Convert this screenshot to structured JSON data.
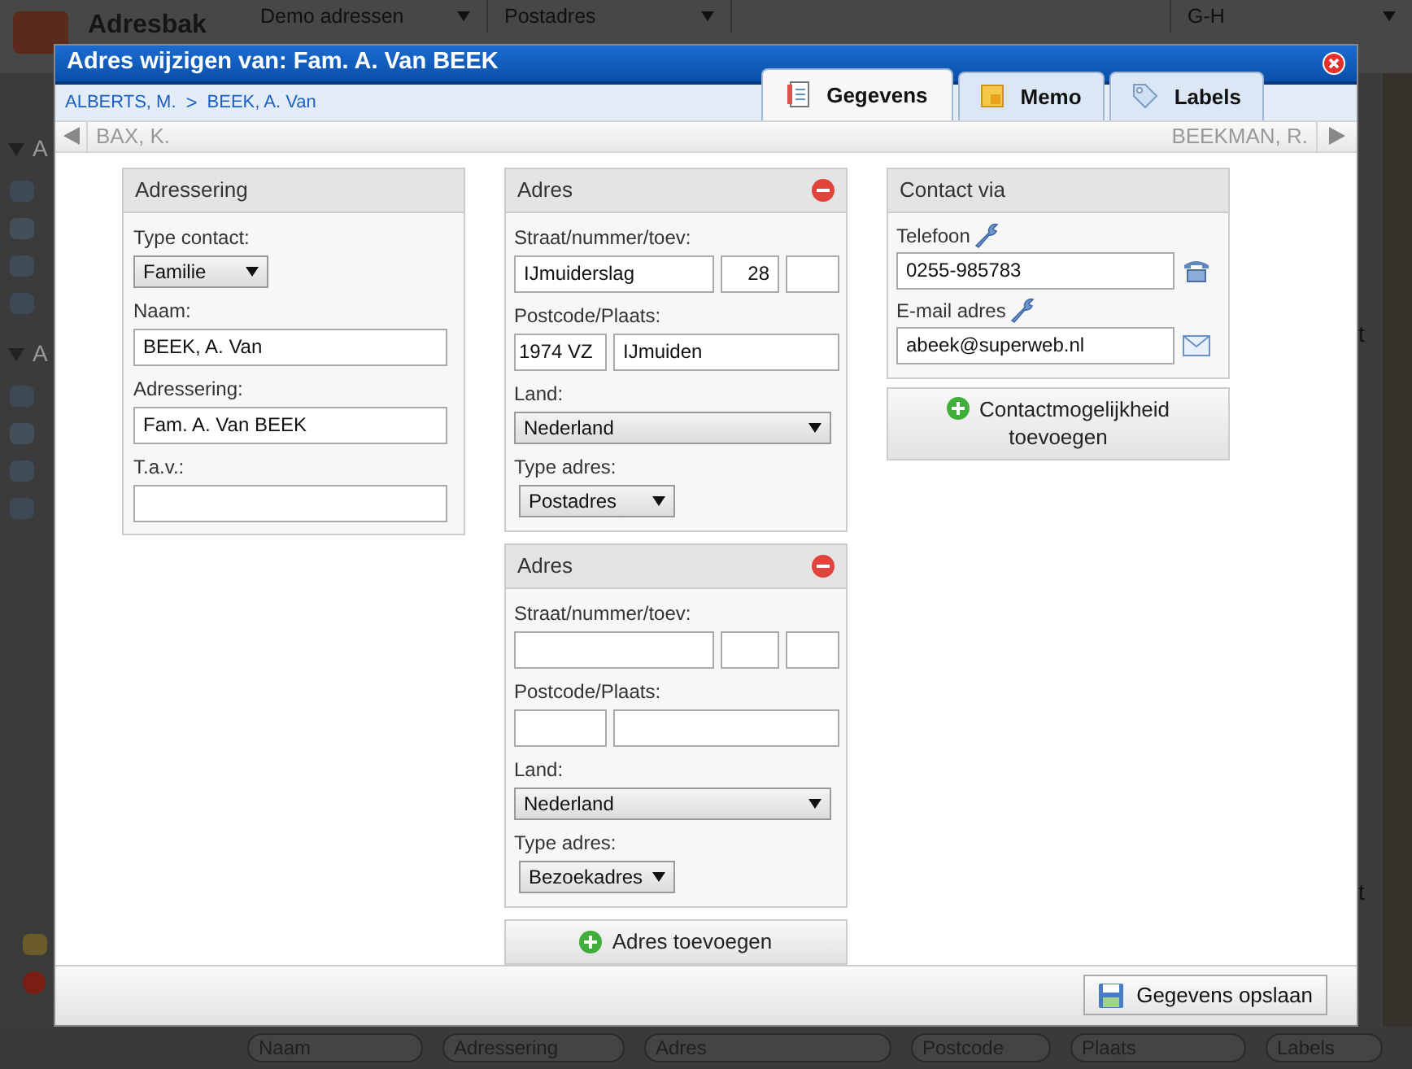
{
  "app": {
    "title": "Adresbak",
    "filters": [
      "Demo adressen",
      "Postadres"
    ],
    "letter_range": "G-H",
    "sidebar_groups": [
      {
        "label": "A",
        "expanded": true
      },
      {
        "label": "A",
        "expanded": true
      }
    ],
    "list_fragments": [
      "t",
      "t"
    ],
    "search_fields": [
      {
        "placeholder": "Naam"
      },
      {
        "placeholder": "Adressering"
      },
      {
        "placeholder": "Adres"
      },
      {
        "placeholder": "Postcode"
      },
      {
        "placeholder": "Plaats"
      },
      {
        "placeholder": "Labels"
      }
    ]
  },
  "dialog": {
    "title": "Adres wijzigen van: Fam. A. Van BEEK",
    "breadcrumb": [
      "ALBERTS, M.",
      "BEEK, A. Van"
    ],
    "breadcrumb_separator": ">",
    "tabs": [
      {
        "label": "Gegevens",
        "kind": "notebook",
        "selected": true
      },
      {
        "label": "Memo",
        "kind": "note",
        "selected": false
      },
      {
        "label": "Labels",
        "kind": "tag",
        "selected": false
      }
    ],
    "navigation": {
      "previous": "BAX, K.",
      "next": "BEEKMAN, R."
    },
    "adressering": {
      "title": "Adressering",
      "fields": [
        {
          "kind": "select",
          "label": "Type contact:",
          "value": "Familie"
        },
        {
          "kind": "text",
          "label": "Naam:",
          "value": "BEEK, A. Van"
        },
        {
          "kind": "text",
          "label": "Adressering:",
          "value": "Fam. A. Van BEEK"
        },
        {
          "kind": "text",
          "label": "T.a.v.:"
        }
      ]
    },
    "addresses": [
      {
        "title": "Adres",
        "street_label": "Straat/nummer/toev:",
        "street": "IJmuiderslag",
        "number": "28",
        "postcode_label": "Postcode/Plaats:",
        "postcode": "1974 VZ",
        "city": "IJmuiden",
        "country_label": "Land:",
        "country": "Nederland",
        "type_label": "Type adres:",
        "type": "Postadres"
      },
      {
        "title": "Adres",
        "street_label": "Straat/nummer/toev:",
        "postcode_label": "Postcode/Plaats:",
        "country_label": "Land:",
        "country": "Nederland",
        "type_label": "Type adres:",
        "type": "Bezoekadres"
      }
    ],
    "add_address_button": "Adres toevoegen",
    "contact": {
      "title": "Contact via",
      "entries": [
        {
          "kind": "phone",
          "label": "Telefoon",
          "value": "0255-985783"
        },
        {
          "kind": "email",
          "label": "E-mail adres",
          "value": "abeek@superweb.nl"
        }
      ],
      "add_button": "Contactmogelijkheid toevoegen"
    },
    "save_button": "Gegevens opslaan"
  }
}
